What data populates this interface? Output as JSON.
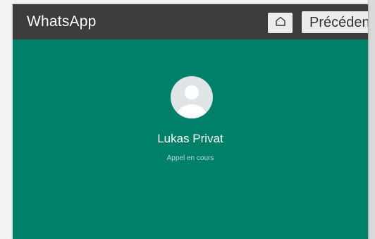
{
  "window": {
    "app_title": "WhatsApp"
  },
  "toolbar": {
    "home_icon": "home-icon",
    "back_label": "Précédent"
  },
  "call": {
    "caller_name": "Lukas Privat",
    "status": "Appel en cours",
    "avatar_icon": "default-avatar-icon"
  },
  "colors": {
    "toolbar_bg": "#3c3c3c",
    "call_bg": "#008069",
    "avatar_bg": "#dfe5e7"
  }
}
